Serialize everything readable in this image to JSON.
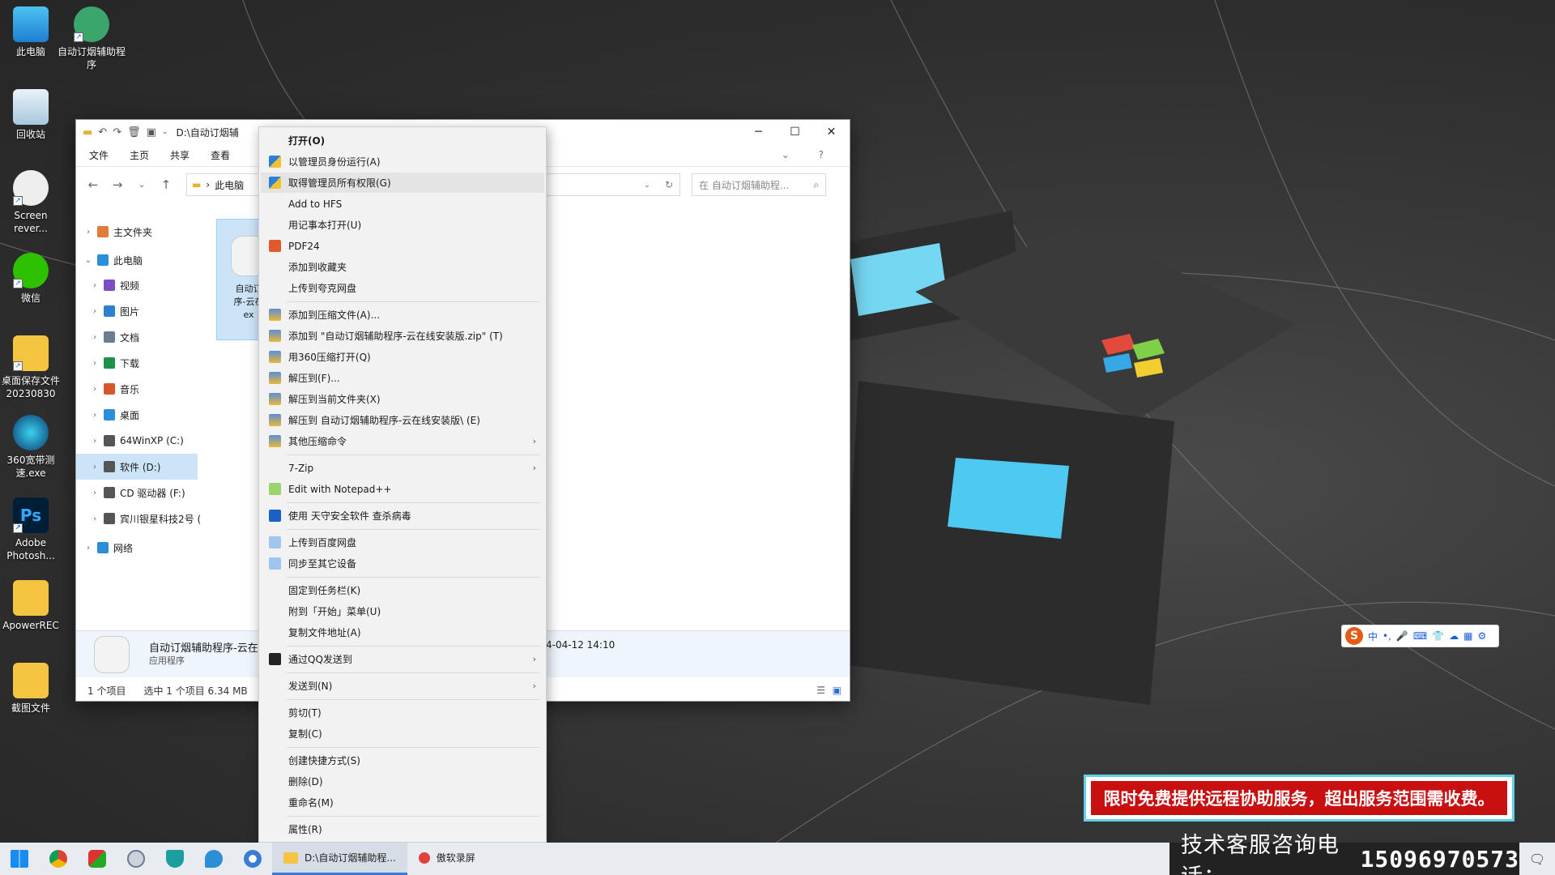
{
  "desktop": {
    "icons": [
      {
        "label": "此电脑"
      },
      {
        "label": "自动订烟辅助程序"
      },
      {
        "label": "回收站"
      },
      {
        "label": "Screen rever..."
      },
      {
        "label": "微信"
      },
      {
        "label": "桌面保存文件 20230830"
      },
      {
        "label": "360宽带测速.exe"
      },
      {
        "label": "Adobe Photosh..."
      },
      {
        "label": "ApowerREC"
      },
      {
        "label": "截图文件"
      }
    ]
  },
  "explorer": {
    "title": "D:\\自动订烟辅",
    "ribbon": [
      "文件",
      "主页",
      "共享",
      "查看"
    ],
    "address": {
      "root": "此电脑"
    },
    "search_placeholder": "在 自动订烟辅助程...",
    "tree": [
      {
        "label": "主文件夹",
        "icon": "home-icon",
        "color": "#e07b39"
      },
      {
        "label": "此电脑",
        "icon": "pc-icon",
        "color": "#2a8fd6",
        "expanded": true
      },
      {
        "label": "视频",
        "icon": "video-icon",
        "color": "#7b4cc2"
      },
      {
        "label": "图片",
        "icon": "pictures-icon",
        "color": "#2f7fd1"
      },
      {
        "label": "文档",
        "icon": "documents-icon",
        "color": "#6a7d91"
      },
      {
        "label": "下载",
        "icon": "download-icon",
        "color": "#1f8f4e"
      },
      {
        "label": "音乐",
        "icon": "music-icon",
        "color": "#d5572b"
      },
      {
        "label": "桌面",
        "icon": "desktop-icon",
        "color": "#2a8fd6"
      },
      {
        "label": "64WinXP  (C:)",
        "icon": "drive-icon",
        "color": "#555"
      },
      {
        "label": "软件 (D:)",
        "icon": "drive-icon",
        "color": "#555",
        "selected": true
      },
      {
        "label": "CD 驱动器 (F:)",
        "icon": "cd-drive-icon",
        "color": "#555"
      },
      {
        "label": "宾川银星科技2号 (",
        "icon": "drive-icon",
        "color": "#555"
      },
      {
        "label": "网络",
        "icon": "network-icon",
        "color": "#2a8fd6"
      }
    ],
    "file_item": {
      "line1": "自动订",
      "line2": "序-云在",
      "line3": "ex"
    },
    "details": {
      "name": "自动订烟辅助程序-云在",
      "type": "应用程序",
      "date": "4-04-12 14:10"
    },
    "status": {
      "count": "1 个项目",
      "selected": "选中 1 个项目  6.34 MB"
    }
  },
  "context_menu": {
    "items": [
      {
        "label": "打开(O)",
        "bold": true
      },
      {
        "label": "以管理员身份运行(A)",
        "icon": "shield-icon"
      },
      {
        "label": "取得管理员所有权限(G)",
        "icon": "shield-icon",
        "hover": true
      },
      {
        "label": "Add to HFS"
      },
      {
        "label": "用记事本打开(U)"
      },
      {
        "label": "PDF24",
        "icon": "pdf24-icon"
      },
      {
        "label": "添加到收藏夹"
      },
      {
        "label": "上传到夸克网盘"
      },
      {
        "label": "添加到压缩文件(A)...",
        "icon": "archive-icon"
      },
      {
        "label": "添加到 \"自动订烟辅助程序-云在线安装版.zip\" (T)",
        "icon": "archive-icon"
      },
      {
        "label": "用360压缩打开(Q)",
        "icon": "archive-icon"
      },
      {
        "label": "解压到(F)...",
        "icon": "archive-icon"
      },
      {
        "label": "解压到当前文件夹(X)",
        "icon": "archive-icon"
      },
      {
        "label": "解压到 自动订烟辅助程序-云在线安装版\\ (E)",
        "icon": "archive-icon"
      },
      {
        "label": "其他压缩命令",
        "icon": "archive-icon",
        "submenu": true
      },
      {
        "label": "7-Zip",
        "submenu": true
      },
      {
        "label": "Edit with Notepad++",
        "icon": "notepadpp-icon"
      },
      {
        "label": "使用 天守安全软件 查杀病毒",
        "icon": "antivirus-icon"
      },
      {
        "label": "上传到百度网盘",
        "icon": "baidu-cloud-icon"
      },
      {
        "label": "同步至其它设备",
        "icon": "baidu-cloud-icon"
      },
      {
        "label": "固定到任务栏(K)"
      },
      {
        "label": "附到「开始」菜单(U)"
      },
      {
        "label": "复制文件地址(A)"
      },
      {
        "label": "通过QQ发送到",
        "icon": "qq-icon",
        "submenu": true
      },
      {
        "label": "发送到(N)",
        "submenu": true
      },
      {
        "label": "剪切(T)"
      },
      {
        "label": "复制(C)"
      },
      {
        "label": "创建快捷方式(S)"
      },
      {
        "label": "删除(D)"
      },
      {
        "label": "重命名(M)"
      },
      {
        "label": "属性(R)"
      }
    ]
  },
  "ime": {
    "mode": "中"
  },
  "banner": {
    "text": "限时免费提供远程协助服务，超出服务范围需收费。"
  },
  "taskbar": {
    "apps": [
      {
        "label": "D:\\自动订烟辅助程...",
        "active": true
      },
      {
        "label": "傲软录屏"
      }
    ],
    "phone_label": "技术客服咨询电话：",
    "phone_number": "15096970573"
  },
  "colors": {
    "accent": "#3a7bd5",
    "banner_red": "#c91010",
    "banner_border": "#5fd1e8",
    "selection": "#cce4f7"
  }
}
